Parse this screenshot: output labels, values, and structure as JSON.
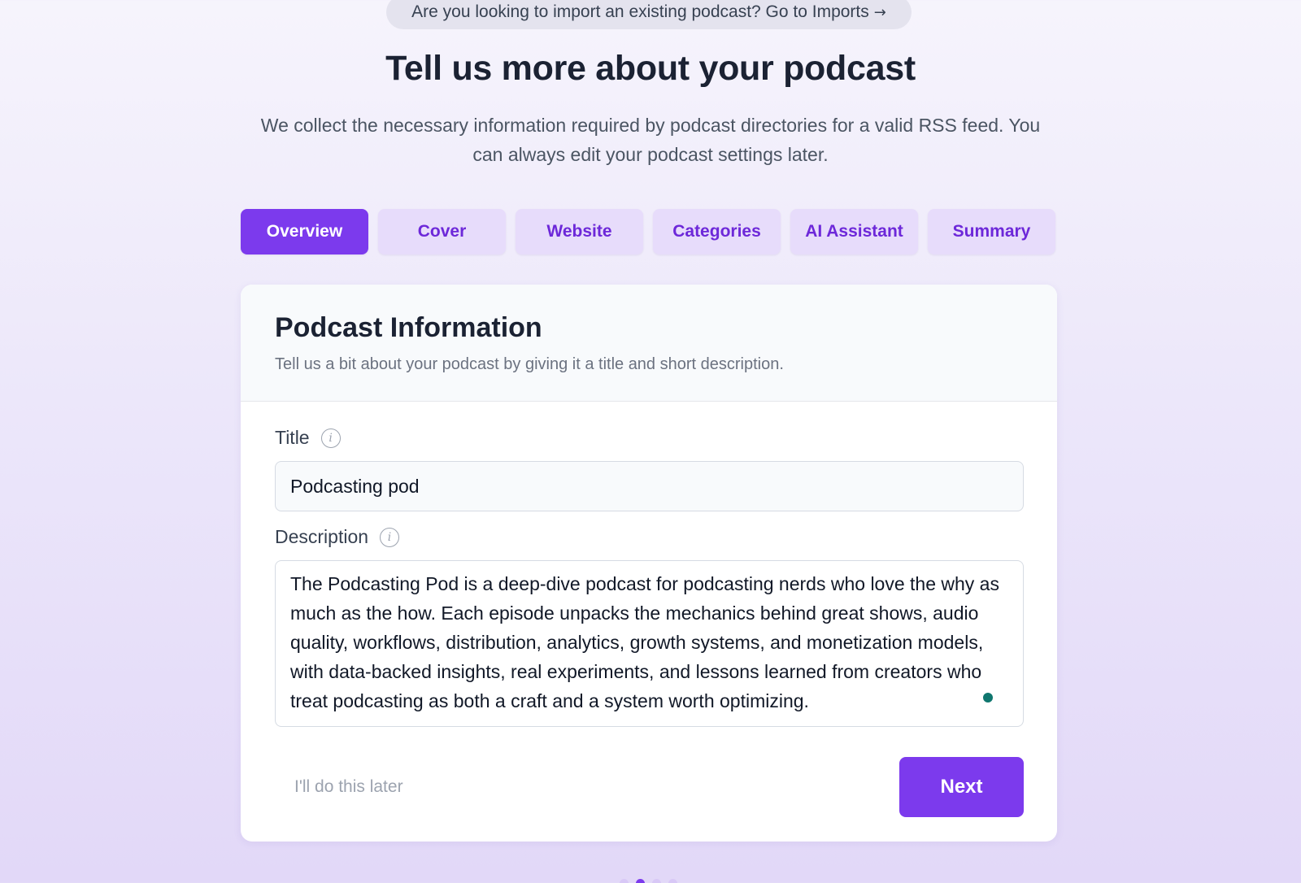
{
  "import_banner": {
    "text": "Are you looking to import an existing podcast? Go to Imports",
    "arrow": "→"
  },
  "header": {
    "title": "Tell us more about your podcast",
    "subtitle": "We collect the necessary information required by podcast directories for a valid RSS feed. You can always edit your podcast settings later."
  },
  "tabs": [
    {
      "label": "Overview",
      "active": true
    },
    {
      "label": "Cover",
      "active": false
    },
    {
      "label": "Website",
      "active": false
    },
    {
      "label": "Categories",
      "active": false
    },
    {
      "label": "AI Assistant",
      "active": false
    },
    {
      "label": "Summary",
      "active": false
    }
  ],
  "card": {
    "title": "Podcast Information",
    "description": "Tell us a bit about your podcast by giving it a title and short description.",
    "title_field": {
      "label": "Title",
      "value": "Podcasting pod",
      "info_icon": "info-icon"
    },
    "description_field": {
      "label": "Description",
      "value": "The Podcasting Pod is a deep-dive podcast for podcasting nerds who love the why as much as the how. Each episode unpacks the mechanics behind great shows, audio quality, workflows, distribution, analytics, growth systems, and monetization models, with data-backed insights, real experiments, and lessons learned from creators who treat podcasting as both a craft and a system worth optimizing.",
      "info_icon": "info-icon"
    },
    "later_label": "I'll do this later",
    "next_label": "Next"
  },
  "progress": {
    "steps": 4,
    "current": 2
  },
  "colors": {
    "accent": "#7c3aed",
    "tab_inactive_bg": "#e7dcfb",
    "tab_inactive_text": "#6d28d9"
  }
}
